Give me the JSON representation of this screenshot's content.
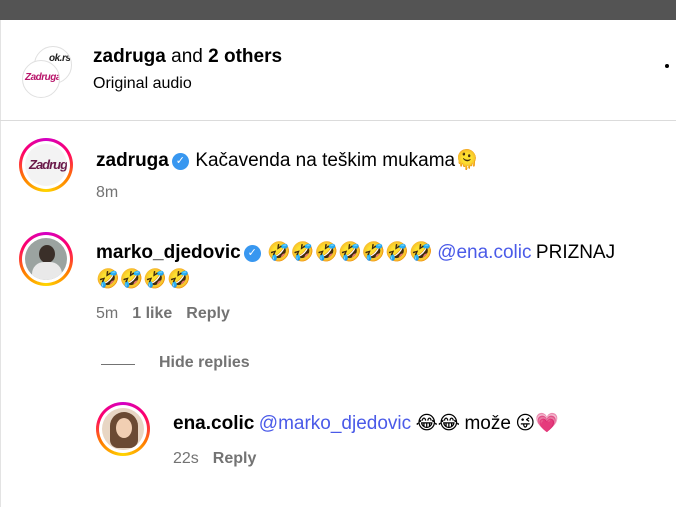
{
  "header": {
    "account": "zadruga",
    "and_text": " and ",
    "others": "2 others",
    "subtitle": "Original audio",
    "avatar_logo_front": "Zadruga",
    "avatar_logo_back": "ok.rs"
  },
  "comments": [
    {
      "username": "zadruga",
      "text": "Kačavenda na teškim mukama",
      "emoji": "🫠",
      "time": "8m",
      "avatar_logo": "Zadruga"
    },
    {
      "username": "marko_djedovic",
      "emoji_run_1": "🤣🤣🤣🤣🤣🤣🤣",
      "mention": "@ena.colic",
      "text": "PRIZNAJ",
      "emoji_run_2": "🤣🤣🤣🤣",
      "time": "5m",
      "likes": "1 like",
      "reply": "Reply",
      "hide_replies": "Hide replies"
    }
  ],
  "reply": {
    "username": "ena.colic",
    "mention": "@marko_djedovic",
    "emoji_1": "😂😂",
    "text": "može",
    "emoji_2": "😜💗",
    "time": "22s",
    "reply": "Reply"
  },
  "colors": {
    "mention": "#4a5ae8",
    "meta": "#737373",
    "verified": "#3897f0"
  }
}
